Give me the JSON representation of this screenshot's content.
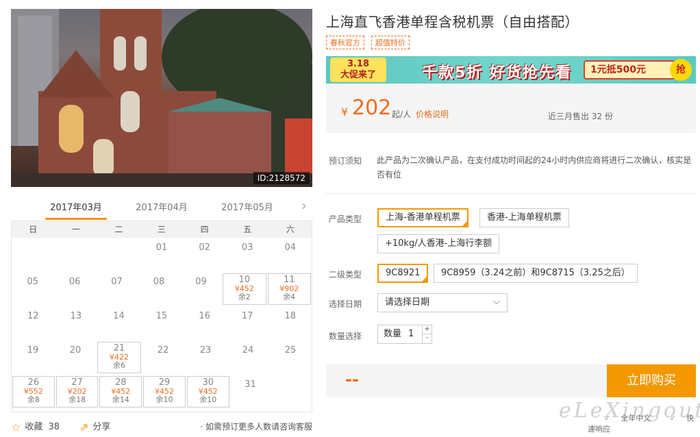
{
  "photo": {
    "id_label": "ID:2128572"
  },
  "months": [
    "2017年03月",
    "2017年04月",
    "2017年05月"
  ],
  "weekdays": [
    "日",
    "一",
    "二",
    "三",
    "四",
    "五",
    "六"
  ],
  "calendar_rows": [
    [
      {
        "d": ""
      },
      {
        "d": ""
      },
      {
        "d": ""
      },
      {
        "d": "01"
      },
      {
        "d": "02"
      },
      {
        "d": "03"
      },
      {
        "d": "04"
      }
    ],
    [
      {
        "d": "05"
      },
      {
        "d": "06"
      },
      {
        "d": "07"
      },
      {
        "d": "08"
      },
      {
        "d": "09"
      },
      {
        "d": "10",
        "p": "¥452",
        "s": "余2"
      },
      {
        "d": "11",
        "p": "¥902",
        "s": "余4"
      }
    ],
    [
      {
        "d": "12"
      },
      {
        "d": "13"
      },
      {
        "d": "14"
      },
      {
        "d": "15"
      },
      {
        "d": "16"
      },
      {
        "d": "17"
      },
      {
        "d": "18"
      }
    ],
    [
      {
        "d": "19"
      },
      {
        "d": "20"
      },
      {
        "d": "21",
        "p": "¥422",
        "s": "余6"
      },
      {
        "d": "22"
      },
      {
        "d": "23"
      },
      {
        "d": "24"
      },
      {
        "d": "25"
      }
    ],
    [
      {
        "d": "26",
        "p": "¥552",
        "s": "余8"
      },
      {
        "d": "27",
        "p": "¥202",
        "s": "余18"
      },
      {
        "d": "28",
        "p": "¥452",
        "s": "余14"
      },
      {
        "d": "29",
        "p": "¥452",
        "s": "余10"
      },
      {
        "d": "30",
        "p": "¥452",
        "s": "余10"
      },
      {
        "d": "31"
      },
      {
        "d": ""
      }
    ]
  ],
  "bottom": {
    "fav_label": "收藏",
    "fav_count": "38",
    "share_label": "分享",
    "consult": "· 如需预订更多人数请咨询客服"
  },
  "title": "上海直飞香港单程含税机票（自由搭配）",
  "tags": [
    "春秋官方",
    "超值特价"
  ],
  "banner": {
    "badge_line1": "3.18",
    "badge_line2": "大促来了",
    "main": "千款5折 好货抢先看",
    "coupon": "1元抵500元",
    "grab": "抢"
  },
  "price": {
    "currency": "¥",
    "amount": "202",
    "unit": "起/人",
    "explain": "价格说明",
    "sold": "近三月售出 32 份"
  },
  "notice": {
    "label": "预订须知",
    "text": "此产品为二次确认产品，在支付成功时间起的24小时内供应商将进行二次确认，核实是否有位"
  },
  "product_type": {
    "label": "产品类型",
    "options": [
      "上海-香港单程机票",
      "香港-上海单程机票",
      "+10kg/人香港-上海行李额"
    ]
  },
  "sub_type": {
    "label": "二级类型",
    "options": [
      "9C8921",
      "9C8959（3.24之前）和9C8715（3.25之后）"
    ]
  },
  "date": {
    "label": "选择日期",
    "placeholder": "请选择日期"
  },
  "quantity": {
    "label": "数量选择",
    "prefix": "数量",
    "value": "1"
  },
  "buy": {
    "total": "--",
    "button": "立即购买"
  },
  "footer": {
    "item1": "全年中文",
    "item2": "快速响应"
  },
  "watermark": "eLeXingout",
  "colors": {
    "accent": "#f39800",
    "price": "#f26c1e"
  }
}
